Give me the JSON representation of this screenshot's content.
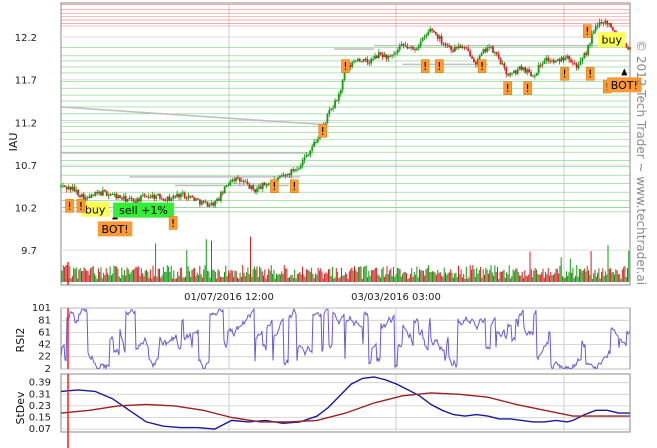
{
  "watermark": "© 2012 Tech Trader ~ www.techtrader.ai",
  "colors": {
    "up": "#119911",
    "down": "#cc2222",
    "rsi": "#6a5acd",
    "stdev_fast": "#1a1a99",
    "stdev_slow": "#992222",
    "support": "#66cc66",
    "resistance": "#ee6666",
    "level": "#bbbbbb",
    "tag_buy": "#ffff55",
    "tag_bot": "#ff9933",
    "tag_sell": "#33ee33",
    "tag_alert": "#ff9933"
  },
  "chart_data": [
    {
      "type": "candlestick",
      "title": "",
      "ylabel": "IAU",
      "yticks": [
        9.7,
        10.2,
        10.7,
        11.2,
        11.7,
        12.2
      ],
      "ylim": [
        9.35,
        12.6
      ],
      "xticks": [
        "01/07/2016 12:00",
        "03/03/2016 03:00"
      ],
      "grid": true,
      "anchors": [
        [
          0,
          10.45
        ],
        [
          0.02,
          10.42
        ],
        [
          0.045,
          10.3
        ],
        [
          0.06,
          10.35
        ],
        [
          0.075,
          10.38
        ],
        [
          0.09,
          10.35
        ],
        [
          0.11,
          10.3
        ],
        [
          0.13,
          10.28
        ],
        [
          0.15,
          10.34
        ],
        [
          0.17,
          10.33
        ],
        [
          0.19,
          10.3
        ],
        [
          0.21,
          10.36
        ],
        [
          0.23,
          10.32
        ],
        [
          0.25,
          10.25
        ],
        [
          0.265,
          10.24
        ],
        [
          0.275,
          10.28
        ],
        [
          0.3,
          10.55
        ],
        [
          0.32,
          10.5
        ],
        [
          0.34,
          10.4
        ],
        [
          0.36,
          10.48
        ],
        [
          0.38,
          10.52
        ],
        [
          0.4,
          10.6
        ],
        [
          0.42,
          10.7
        ],
        [
          0.44,
          10.9
        ],
        [
          0.455,
          11.05
        ],
        [
          0.47,
          11.3
        ],
        [
          0.48,
          11.4
        ],
        [
          0.49,
          11.55
        ],
        [
          0.5,
          11.8
        ],
        [
          0.52,
          11.95
        ],
        [
          0.54,
          11.9
        ],
        [
          0.56,
          12.0
        ],
        [
          0.58,
          11.95
        ],
        [
          0.6,
          12.1
        ],
        [
          0.62,
          12.05
        ],
        [
          0.64,
          12.2
        ],
        [
          0.65,
          12.3
        ],
        [
          0.67,
          12.15
        ],
        [
          0.69,
          12.05
        ],
        [
          0.7,
          12.1
        ],
        [
          0.72,
          12.0
        ],
        [
          0.73,
          11.9
        ],
        [
          0.75,
          12.1
        ],
        [
          0.77,
          11.95
        ],
        [
          0.78,
          11.8
        ],
        [
          0.79,
          11.75
        ],
        [
          0.81,
          11.85
        ],
        [
          0.83,
          11.75
        ],
        [
          0.85,
          11.95
        ],
        [
          0.87,
          11.9
        ],
        [
          0.89,
          12.0
        ],
        [
          0.9,
          11.9
        ],
        [
          0.91,
          11.85
        ],
        [
          0.925,
          12.05
        ],
        [
          0.935,
          12.25
        ],
        [
          0.95,
          12.4
        ],
        [
          0.965,
          12.35
        ],
        [
          0.975,
          12.25
        ],
        [
          0.985,
          12.15
        ],
        [
          0.995,
          12.1
        ],
        [
          1.0,
          12.05
        ]
      ],
      "levels": [
        {
          "y": 12.48,
          "kind": "resistance"
        },
        {
          "y": 12.44,
          "kind": "resistance"
        },
        {
          "y": 12.4,
          "kind": "resistance"
        },
        {
          "y": 12.36,
          "kind": "resistance"
        },
        {
          "y": 12.33,
          "kind": "resistance"
        },
        {
          "y": 12.58,
          "kind": "resistance"
        },
        {
          "y": 12.52,
          "kind": "resistance"
        },
        {
          "y": 12.08,
          "kind": "support"
        },
        {
          "y": 11.98,
          "kind": "support"
        },
        {
          "y": 11.92,
          "kind": "support"
        },
        {
          "y": 11.85,
          "kind": "support"
        },
        {
          "y": 11.78,
          "kind": "support"
        },
        {
          "y": 11.68,
          "kind": "support"
        },
        {
          "y": 11.6,
          "kind": "support"
        },
        {
          "y": 11.52,
          "kind": "support"
        },
        {
          "y": 11.45,
          "kind": "support"
        },
        {
          "y": 11.38,
          "kind": "support"
        },
        {
          "y": 11.3,
          "kind": "support"
        },
        {
          "y": 11.22,
          "kind": "support"
        },
        {
          "y": 11.15,
          "kind": "support"
        },
        {
          "y": 11.08,
          "kind": "support"
        },
        {
          "y": 11.0,
          "kind": "support"
        },
        {
          "y": 10.92,
          "kind": "support"
        },
        {
          "y": 10.85,
          "kind": "support"
        },
        {
          "y": 10.75,
          "kind": "support"
        },
        {
          "y": 10.68,
          "kind": "support"
        },
        {
          "y": 10.58,
          "kind": "support"
        },
        {
          "y": 10.48,
          "kind": "support"
        },
        {
          "y": 10.38,
          "kind": "support"
        },
        {
          "y": 10.28,
          "kind": "support"
        },
        {
          "y": 10.2,
          "kind": "support"
        },
        {
          "y": 10.15,
          "kind": "support"
        }
      ],
      "diagonal_levels": [
        {
          "x1": 0.0,
          "y1": 11.38,
          "x2": 0.47,
          "y2": 11.17
        },
        {
          "x1": 0.0,
          "y1": 10.84,
          "x2": 0.44,
          "y2": 10.84
        },
        {
          "x1": 0.12,
          "y1": 10.56,
          "x2": 0.42,
          "y2": 10.56
        },
        {
          "x1": 0.2,
          "y1": 10.46,
          "x2": 0.4,
          "y2": 10.46
        },
        {
          "x1": 0.55,
          "y1": 12.1,
          "x2": 1.0,
          "y2": 12.1
        },
        {
          "x1": 0.6,
          "y1": 11.88,
          "x2": 0.75,
          "y2": 11.88
        },
        {
          "x1": 0.48,
          "y1": 12.06,
          "x2": 0.55,
          "y2": 12.06
        }
      ],
      "markers": [
        {
          "type": "alert",
          "label": "!",
          "x": 0.015,
          "y": 10.22
        },
        {
          "type": "buy",
          "label": "buy",
          "x": 0.06,
          "y": 10.18
        },
        {
          "type": "bot",
          "label": "BOT!",
          "x": 0.095,
          "y": 9.95
        },
        {
          "type": "sell",
          "label": "sell +1%",
          "x": 0.145,
          "y": 10.17
        },
        {
          "type": "alert",
          "label": "!",
          "x": 0.197,
          "y": 10.02
        },
        {
          "type": "alert",
          "label": "!",
          "x": 0.035,
          "y": 10.22
        },
        {
          "type": "alert",
          "label": "!",
          "x": 0.375,
          "y": 10.45
        },
        {
          "type": "alert",
          "label": "!",
          "x": 0.41,
          "y": 10.45
        },
        {
          "type": "alert",
          "label": "!",
          "x": 0.46,
          "y": 11.1
        },
        {
          "type": "alert",
          "label": "!",
          "x": 0.5,
          "y": 11.86
        },
        {
          "type": "alert",
          "label": "!",
          "x": 0.64,
          "y": 11.86
        },
        {
          "type": "alert",
          "label": "!",
          "x": 0.665,
          "y": 11.86
        },
        {
          "type": "alert",
          "label": "!",
          "x": 0.785,
          "y": 11.6
        },
        {
          "type": "alert",
          "label": "!",
          "x": 0.74,
          "y": 11.86
        },
        {
          "type": "alert",
          "label": "!",
          "x": 0.93,
          "y": 11.77
        },
        {
          "type": "alert",
          "label": "!",
          "x": 0.925,
          "y": 12.27
        },
        {
          "type": "alert",
          "label": "!",
          "x": 0.96,
          "y": 11.62
        },
        {
          "type": "alert",
          "label": "!",
          "x": 0.82,
          "y": 11.6
        },
        {
          "type": "alert",
          "label": "!",
          "x": 0.885,
          "y": 11.77
        },
        {
          "type": "buy",
          "label": "buy",
          "x": 0.968,
          "y": 12.17
        },
        {
          "type": "bot",
          "label": "BOT!",
          "x": 0.99,
          "y": 11.64
        }
      ]
    },
    {
      "type": "line",
      "ylabel": "RSI2",
      "yticks": [
        2,
        22,
        42,
        61,
        81,
        101
      ],
      "ylim": [
        2,
        101
      ],
      "grid": true
    },
    {
      "type": "line",
      "ylabel": "StDev",
      "yticks": [
        0.07,
        0.15,
        0.23,
        0.31,
        0.39
      ],
      "ylim": [
        0.05,
        0.45
      ],
      "grid": true,
      "series": [
        {
          "values": [
            [
              0,
              0.33
            ],
            [
              0.03,
              0.34
            ],
            [
              0.06,
              0.33
            ],
            [
              0.09,
              0.28
            ],
            [
              0.12,
              0.2
            ],
            [
              0.15,
              0.12
            ],
            [
              0.18,
              0.09
            ],
            [
              0.21,
              0.08
            ],
            [
              0.24,
              0.08
            ],
            [
              0.27,
              0.07
            ],
            [
              0.3,
              0.13
            ],
            [
              0.33,
              0.12
            ],
            [
              0.36,
              0.13
            ],
            [
              0.39,
              0.11
            ],
            [
              0.42,
              0.12
            ],
            [
              0.45,
              0.16
            ],
            [
              0.47,
              0.22
            ],
            [
              0.49,
              0.3
            ],
            [
              0.51,
              0.38
            ],
            [
              0.53,
              0.42
            ],
            [
              0.55,
              0.43
            ],
            [
              0.57,
              0.41
            ],
            [
              0.59,
              0.38
            ],
            [
              0.61,
              0.34
            ],
            [
              0.63,
              0.3
            ],
            [
              0.65,
              0.24
            ],
            [
              0.67,
              0.2
            ],
            [
              0.69,
              0.17
            ],
            [
              0.71,
              0.16
            ],
            [
              0.73,
              0.17
            ],
            [
              0.75,
              0.16
            ],
            [
              0.77,
              0.14
            ],
            [
              0.79,
              0.14
            ],
            [
              0.81,
              0.13
            ],
            [
              0.83,
              0.12
            ],
            [
              0.85,
              0.12
            ],
            [
              0.87,
              0.13
            ],
            [
              0.89,
              0.12
            ],
            [
              0.9,
              0.13
            ],
            [
              0.92,
              0.17
            ],
            [
              0.94,
              0.2
            ],
            [
              0.96,
              0.2
            ],
            [
              0.98,
              0.18
            ],
            [
              1.0,
              0.18
            ]
          ]
        },
        {
          "values": [
            [
              0,
              0.18
            ],
            [
              0.05,
              0.2
            ],
            [
              0.1,
              0.23
            ],
            [
              0.15,
              0.24
            ],
            [
              0.2,
              0.23
            ],
            [
              0.25,
              0.2
            ],
            [
              0.3,
              0.15
            ],
            [
              0.35,
              0.12
            ],
            [
              0.4,
              0.12
            ],
            [
              0.45,
              0.13
            ],
            [
              0.5,
              0.18
            ],
            [
              0.55,
              0.25
            ],
            [
              0.6,
              0.3
            ],
            [
              0.65,
              0.32
            ],
            [
              0.7,
              0.31
            ],
            [
              0.75,
              0.29
            ],
            [
              0.8,
              0.24
            ],
            [
              0.85,
              0.2
            ],
            [
              0.9,
              0.16
            ],
            [
              0.95,
              0.16
            ],
            [
              1.0,
              0.16
            ]
          ]
        }
      ]
    }
  ]
}
